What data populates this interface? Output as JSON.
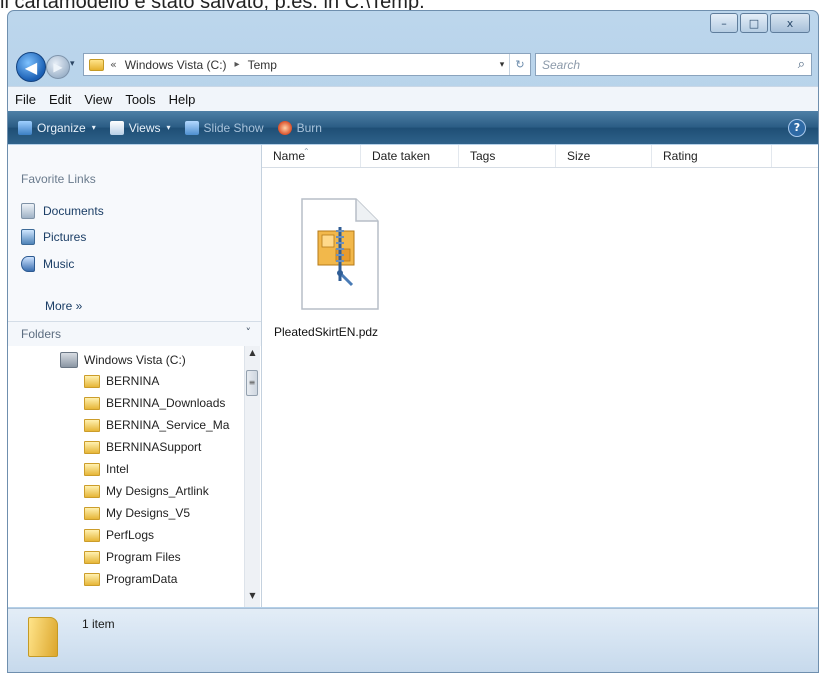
{
  "window": {
    "caption_buttons": {
      "minimize": "–",
      "maximize": "□",
      "close": "x"
    }
  },
  "above_text": "il cartamodello è stato salvato, p.es. in C:\\Temp.",
  "address_bar": {
    "overflow_chevron": "«",
    "crumbs": [
      "Windows Vista (C:)",
      "Temp"
    ],
    "separator": "▸",
    "dropdown_glyph": "▾",
    "refresh_glyph": "↻"
  },
  "search": {
    "placeholder": "Search",
    "icon": "search-icon"
  },
  "menu": [
    "File",
    "Edit",
    "View",
    "Tools",
    "Help"
  ],
  "commands": {
    "organize": "Organize",
    "views": "Views",
    "slideshow": "Slide Show",
    "burn": "Burn",
    "arrow": "▾",
    "help": "?"
  },
  "favorites": {
    "title": "Favorite Links",
    "items": [
      "Documents",
      "Pictures",
      "Music"
    ],
    "more": "More »"
  },
  "folders": {
    "title": "Folders",
    "chevron": "˅",
    "root": "Windows Vista (C:)",
    "items": [
      "BERNINA",
      "BERNINA_Downloads",
      "BERNINA_Service_Ma",
      "BERNINASupport",
      "Intel",
      "My Designs_Artlink",
      "My Designs_V5",
      "PerfLogs",
      "Program Files",
      "ProgramData"
    ]
  },
  "columns": [
    "Name",
    "Date taken",
    "Tags",
    "Size",
    "Rating"
  ],
  "file": {
    "name": "PleatedSkirtEN.pdz",
    "icon": "zip-archive-icon"
  },
  "status": {
    "text": "1 item"
  },
  "colors": {
    "command_bar": "#2a5c84",
    "title_bar": "#a9c8e4",
    "folder_yellow": "#e6b637"
  }
}
